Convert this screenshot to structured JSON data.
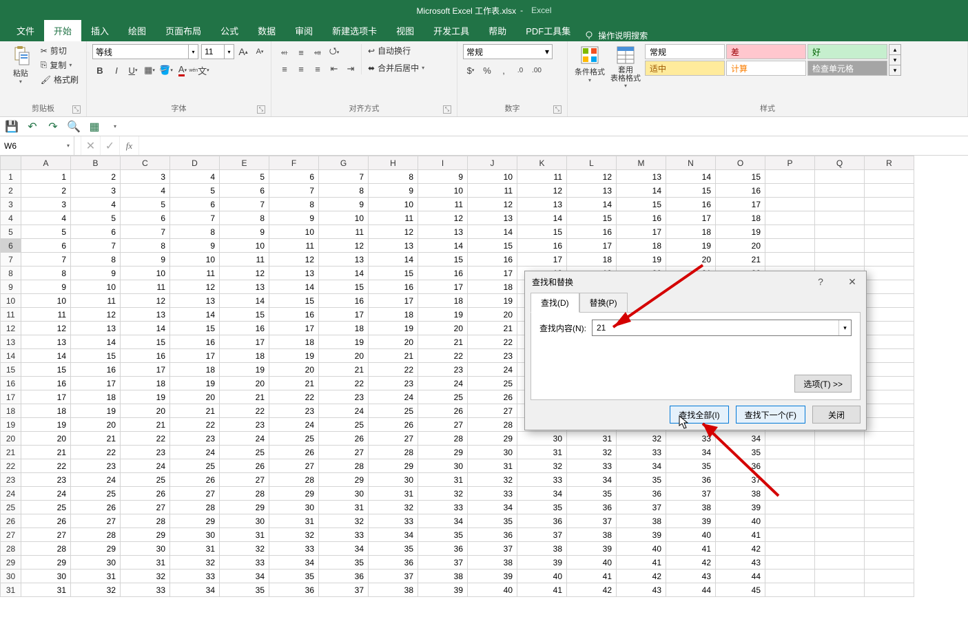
{
  "title": {
    "filename": "Microsoft Excel 工作表.xlsx",
    "sep": "-",
    "app": "Excel"
  },
  "tabs": [
    "文件",
    "开始",
    "插入",
    "绘图",
    "页面布局",
    "公式",
    "数据",
    "审阅",
    "新建选项卡",
    "视图",
    "开发工具",
    "帮助",
    "PDF工具集"
  ],
  "active_tab": 1,
  "tell_me": "操作说明搜索",
  "clipboard": {
    "paste": "粘贴",
    "cut": "剪切",
    "copy": "复制",
    "painter": "格式刷",
    "label": "剪贴板"
  },
  "font": {
    "name": "等线",
    "size": "11",
    "label": "字体"
  },
  "align": {
    "wrap": "自动换行",
    "merge": "合并后居中",
    "label": "对齐方式"
  },
  "number": {
    "format": "常规",
    "label": "数字"
  },
  "styles": {
    "cond": "条件格式",
    "table": "套用\n表格格式",
    "cells": [
      {
        "t": "常规",
        "bg": "#ffffff",
        "fg": "#000"
      },
      {
        "t": "差",
        "bg": "#ffc7ce",
        "fg": "#9c0006"
      },
      {
        "t": "好",
        "bg": "#c6efce",
        "fg": "#006100"
      },
      {
        "t": "适中",
        "bg": "#ffeb9c",
        "fg": "#9c5700"
      },
      {
        "t": "计算",
        "bg": "#ffffff",
        "fg": "#fa7d00"
      },
      {
        "t": "检查单元格",
        "bg": "#a5a5a5",
        "fg": "#ffffff"
      }
    ],
    "label": "样式"
  },
  "namebox": "W6",
  "columns": [
    "A",
    "B",
    "C",
    "D",
    "E",
    "F",
    "G",
    "H",
    "I",
    "J",
    "K",
    "L",
    "M",
    "N",
    "O",
    "P",
    "Q",
    "R"
  ],
  "row_count": 31,
  "col_data_count": 15,
  "selected_row": 6,
  "dialog": {
    "title": "查找和替换",
    "tabs": [
      "查找(D)",
      "替换(P)"
    ],
    "active_tab": 0,
    "find_label": "查找内容(N):",
    "find_value": "21",
    "options": "选项(T) >>",
    "find_all": "查找全部(I)",
    "find_next": "查找下一个(F)",
    "close": "关闭"
  }
}
